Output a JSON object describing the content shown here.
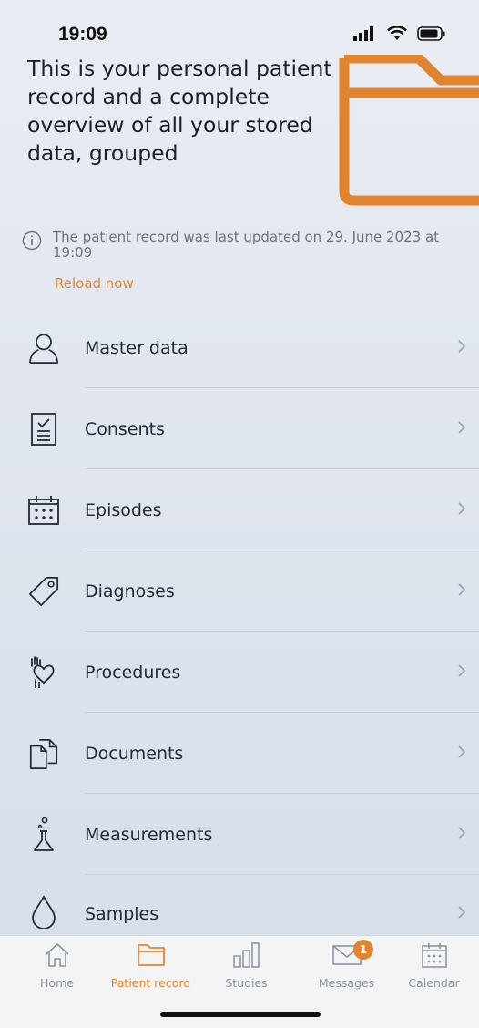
{
  "status_bar": {
    "time": "19:09"
  },
  "header": {
    "text": "This is your personal patient record and a complete overview of all your stored data, grouped",
    "illustration": "folder-icon"
  },
  "info": {
    "icon": "info-icon",
    "text": "The patient record was last updated on 29. June 2023 at 19:09",
    "reload_label": "Reload now"
  },
  "menu": {
    "items": [
      {
        "label": "Master data",
        "icon": "person-icon"
      },
      {
        "label": "Consents",
        "icon": "clipboard-check-icon"
      },
      {
        "label": "Episodes",
        "icon": "calendar-grid-icon"
      },
      {
        "label": "Diagnoses",
        "icon": "tag-icon"
      },
      {
        "label": "Procedures",
        "icon": "hand-heart-icon"
      },
      {
        "label": "Documents",
        "icon": "documents-icon"
      },
      {
        "label": "Measurements",
        "icon": "flask-icon"
      },
      {
        "label": "Samples",
        "icon": "drop-icon"
      }
    ]
  },
  "tabbar": {
    "tabs": [
      {
        "label": "Home",
        "icon": "home-icon",
        "active": false
      },
      {
        "label": "Patient record",
        "icon": "folder-icon",
        "active": true
      },
      {
        "label": "Studies",
        "icon": "bar-chart-icon",
        "active": false
      },
      {
        "label": "Messages",
        "icon": "envelope-icon",
        "active": false,
        "badge": "1"
      },
      {
        "label": "Calendar",
        "icon": "calendar-icon",
        "active": false
      }
    ]
  },
  "colors": {
    "accent": "#e0852d",
    "text_primary": "#232a36",
    "text_secondary": "#6b7280",
    "tab_inactive": "#8b929c"
  }
}
